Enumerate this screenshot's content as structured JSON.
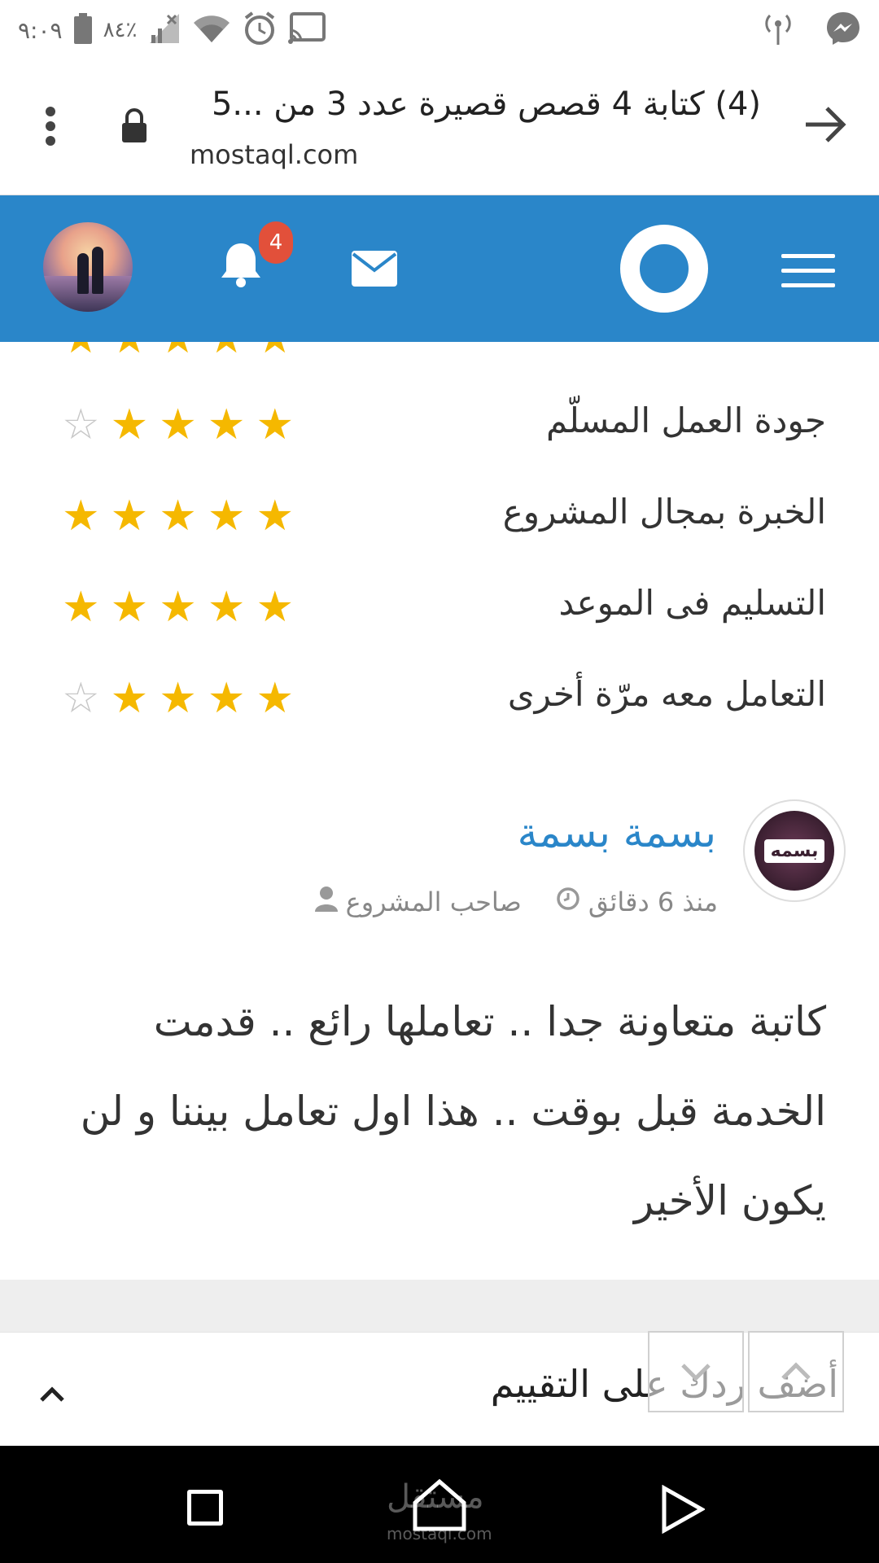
{
  "status_bar": {
    "time": "٩:٠٩",
    "battery_percent": "٨٤٪",
    "icons": [
      "battery-icon",
      "no-signal-icon",
      "wifi-icon",
      "alarm-icon",
      "cast-icon",
      "hotspot-icon",
      "messenger-icon"
    ]
  },
  "browser": {
    "page_title": "(4) كتابة 4 قصص قصيرة عدد 3 من ...5",
    "domain": "mostaql.com"
  },
  "header": {
    "notification_count": "4",
    "colors": {
      "header_bg": "#2a86c9",
      "badge_bg": "#e2503a"
    }
  },
  "ratings": [
    {
      "label": "جودة العمل المسلّم",
      "stars": 4,
      "max": 5
    },
    {
      "label": "الخبرة بمجال المشروع",
      "stars": 5,
      "max": 5
    },
    {
      "label": "التسليم فى الموعد",
      "stars": 5,
      "max": 5
    },
    {
      "label": "التعامل معه مرّة أخرى",
      "stars": 4,
      "max": 5
    }
  ],
  "review": {
    "avatar_text": "بسمه",
    "author": "بسمة بسمة",
    "role": "صاحب المشروع",
    "time_ago": "منذ 6 دقائق",
    "body_lines": [
      "كاتبة متعاونة جدا .. تعاملها رائع .. قدمت",
      "الخدمة قبل بوقت .. هذا اول تعامل بيننا و لن",
      "يكون الأخير"
    ]
  },
  "reply_bar": {
    "label": "أضف ردك على التقييم"
  },
  "watermark": {
    "arabic": "مستقل",
    "latin": "mostaql.com"
  }
}
